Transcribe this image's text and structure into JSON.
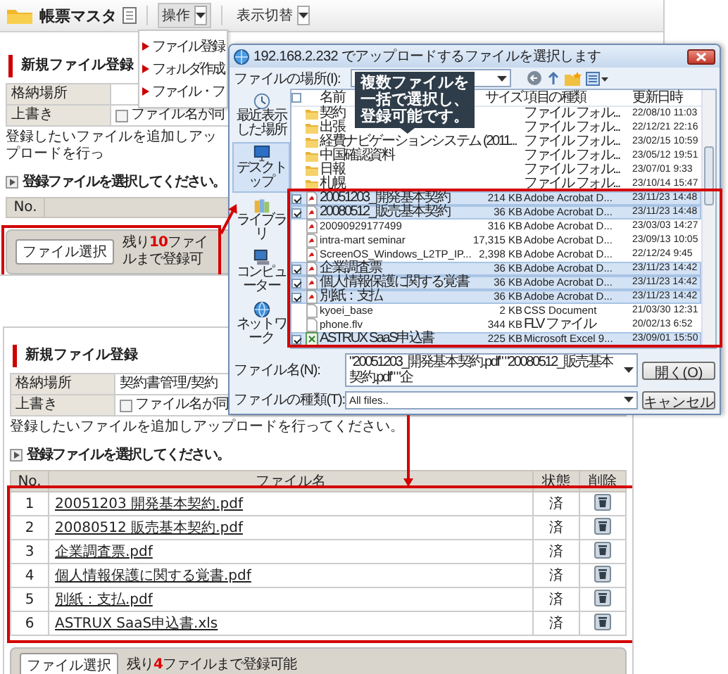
{
  "top_panel": {
    "toolbar": {
      "title": "帳票マスタ",
      "menus": [
        {
          "label": "操作",
          "expanded": true,
          "items": [
            "ファイル登録",
            "フォルダ作成",
            "ファイル・フ"
          ]
        },
        {
          "label": "表示切替",
          "expanded": false
        }
      ]
    },
    "section_title": "新規ファイル登録",
    "fields": [
      {
        "kind": "text",
        "label": "格納場所"
      },
      {
        "kind": "checkbox",
        "label": "上書き",
        "checked": false,
        "text": "ファイル名が同"
      }
    ],
    "instruction": "登録したいファイルを追加しアップロードを行っ",
    "list_heading": "登録ファイルを選択してください。",
    "table": {
      "columns": [
        "No."
      ]
    },
    "footer": {
      "button": "ファイル選択",
      "remaining": "残り**10**ファイルまで登録可",
      "highlighted": true
    }
  },
  "dialog": {
    "title": "192.168.2.232 でアップロードするファイルを選択します",
    "location_label": "ファイルの場所(I):",
    "places": [
      {
        "kind": "recent",
        "label": "最近表示した場所",
        "selected": false
      },
      {
        "kind": "desktop",
        "label": "デスクトップ",
        "selected": true
      },
      {
        "kind": "library",
        "label": "ライブラリ",
        "selected": false
      },
      {
        "kind": "computer",
        "label": "コンピューター",
        "selected": false
      },
      {
        "kind": "network",
        "label": "ネットワーク",
        "selected": false
      }
    ],
    "header_checked": false,
    "columns": [
      "名前",
      "サイズ",
      "項目の種類",
      "更新日時"
    ],
    "files": [
      {
        "kind": "folder",
        "name": "契約",
        "type": "ファイル フォル...",
        "modified": "22/08/10 11:03",
        "selected": false
      },
      {
        "kind": "folder",
        "name": "出張",
        "type": "ファイル フォル...",
        "modified": "22/12/21 22:16",
        "selected": false
      },
      {
        "kind": "folder",
        "name": "経費ナビゲーションシステム (2011...",
        "type": "ファイル フォル...",
        "modified": "23/02/15 10:59",
        "selected": false
      },
      {
        "kind": "folder",
        "name": "中国確認資料",
        "type": "ファイル フォル...",
        "modified": "23/05/12 19:51",
        "selected": false
      },
      {
        "kind": "folder",
        "name": "日報",
        "type": "ファイル フォル...",
        "modified": "23/07/01 9:33",
        "selected": false
      },
      {
        "kind": "folder",
        "name": "札幌",
        "type": "ファイル フォル...",
        "modified": "23/10/14 15:47",
        "selected": false
      },
      {
        "kind": "pdf",
        "name": "20051203_開発基本契約",
        "size": "214 KB",
        "type": "Adobe Acrobat D...",
        "modified": "23/11/23 14:48",
        "selected": true
      },
      {
        "kind": "pdf",
        "name": "20080512_販売基本契約",
        "size": "36 KB",
        "type": "Adobe Acrobat D...",
        "modified": "23/11/23 14:48",
        "selected": true
      },
      {
        "kind": "pdf",
        "name": "20090929177499",
        "size": "316 KB",
        "type": "Adobe Acrobat D...",
        "modified": "23/03/03 14:27",
        "selected": false
      },
      {
        "kind": "pdf",
        "name": "intra-mart seminar",
        "size": "17,315 KB",
        "type": "Adobe Acrobat D...",
        "modified": "23/09/13 10:05",
        "selected": false
      },
      {
        "kind": "pdf",
        "name": "ScreenOS_Windows_L2TP_IP...",
        "size": "2,398 KB",
        "type": "Adobe Acrobat D...",
        "modified": "22/12/24 9:45",
        "selected": false
      },
      {
        "kind": "pdf",
        "name": "企業調査票",
        "size": "36 KB",
        "type": "Adobe Acrobat D...",
        "modified": "23/11/23 14:42",
        "selected": true
      },
      {
        "kind": "pdf",
        "name": "個人情報保護に関する覚書",
        "size": "36 KB",
        "type": "Adobe Acrobat D...",
        "modified": "23/11/23 14:42",
        "selected": true
      },
      {
        "kind": "pdf",
        "name": "別紙：支払",
        "size": "36 KB",
        "type": "Adobe Acrobat D...",
        "modified": "23/11/23 14:42",
        "selected": true
      },
      {
        "kind": "file",
        "name": "kyoei_base",
        "size": "2 KB",
        "type": "CSS Document",
        "modified": "21/03/30 12:31",
        "selected": false
      },
      {
        "kind": "file",
        "name": "phone.flv",
        "size": "344 KB",
        "type": "FLV ファイル",
        "modified": "20/02/13 6:52",
        "selected": false
      },
      {
        "kind": "sheet",
        "name": "ASTRUX SaaS申込書",
        "size": "225 KB",
        "type": "Microsoft Excel 9...",
        "modified": "23/09/01 15:50",
        "selected": true
      }
    ],
    "files_highlighted": true,
    "filename_label": "ファイル名(N):",
    "filename_value": "\"20051203_開発基本契約.pdf\" \"20080512_販売基本契約.pdf\" \"企",
    "filetype_label": "ファイルの種類(T):",
    "filetype_value": "All files..",
    "buttons": [
      "開く(O)",
      "キャンセル"
    ],
    "tip": "複数ファイルを一括で選択し、登録可能です。"
  },
  "bottom_panel": {
    "section_title": "新規ファイル登録",
    "fields": [
      {
        "kind": "text",
        "label": "格納場所",
        "value": "契約書管理/契約"
      },
      {
        "kind": "checkbox",
        "label": "上書き",
        "checked": false,
        "text": "ファイル名が同"
      }
    ],
    "instruction": "登録したいファイルを追加しアップロードを行ってください。",
    "list_heading": "登録ファイルを選択してください。",
    "table": {
      "columns": [
        "No.",
        "ファイル名",
        "状態",
        "削除"
      ],
      "highlighted": true,
      "rows": [
        {
          "no": "1",
          "name": "20051203 開発基本契約.pdf",
          "status": "済"
        },
        {
          "no": "2",
          "name": "20080512 販売基本契約.pdf",
          "status": "済"
        },
        {
          "no": "3",
          "name": "企業調査票.pdf",
          "status": "済"
        },
        {
          "no": "4",
          "name": "個人情報保護に関する覚書.pdf",
          "status": "済"
        },
        {
          "no": "5",
          "name": "別紙：支払.pdf",
          "status": "済"
        },
        {
          "no": "6",
          "name": "ASTRUX SaaS申込書.xls",
          "status": "済"
        }
      ]
    },
    "footer": {
      "button": "ファイル選択",
      "remaining": "残り**4**ファイルまで登録可能"
    }
  }
}
